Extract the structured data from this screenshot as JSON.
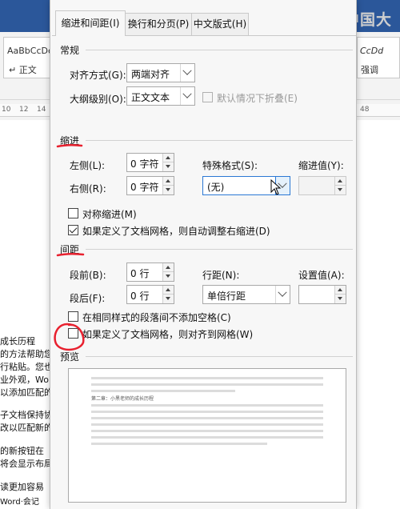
{
  "logo": {
    "text": "中国大"
  },
  "ribbon": {
    "style_left_1": "AaBbCcDc",
    "style_left_2": "↵ 正文",
    "style_right_1": "CcDd",
    "style_right_2": "强调"
  },
  "ruler": {
    "left_ticks": [
      "10",
      "12",
      "14"
    ],
    "right_tick": "48"
  },
  "document": {
    "lines": [
      "成长历程",
      "的方法帮助您",
      "行粘贴。您也",
      "业外观，Wor",
      "以添加匹配的",
      "子文档保持协",
      "改以匹配新的",
      "的新按钮在",
      "将会显示布局",
      "读更加容易",
      "Word·会记"
    ]
  },
  "dialog": {
    "tabs": [
      "缩进和间距(I)",
      "换行和分页(P)",
      "中文版式(H)"
    ],
    "general": {
      "title": "常规",
      "alignment_label": "对齐方式(G):",
      "alignment_value": "两端对齐",
      "outline_label": "大纲级别(O):",
      "outline_value": "正文文本",
      "collapse_label": "默认情况下折叠(E)"
    },
    "indent": {
      "title": "缩进",
      "left_label": "左侧(L):",
      "left_value": "0 字符",
      "right_label": "右侧(R):",
      "right_value": "0 字符",
      "special_label": "特殊格式(S):",
      "special_value": "(无)",
      "by_label": "缩进值(Y):",
      "by_value": "",
      "mirror_label": "对称缩进(M)",
      "auto_adjust_label": "如果定义了文档网格，则自动调整右缩进(D)"
    },
    "spacing": {
      "title": "间距",
      "before_label": "段前(B):",
      "before_value": "0 行",
      "after_label": "段后(F):",
      "after_value": "0 行",
      "line_spacing_label": "行距(N):",
      "line_spacing_value": "单倍行距",
      "at_label": "设置值(A):",
      "at_value": "",
      "no_space_label": "在相同样式的段落间不添加空格(C)",
      "snap_grid_label": "如果定义了文档网格，则对齐到网格(W)"
    },
    "preview": {
      "title": "预览",
      "sample_text": "第二章：小黑老师的成长历程"
    }
  },
  "colors": {
    "annotation": "#e8212f",
    "focus": "#2b78d4"
  },
  "checkbox_states": {
    "mirror": false,
    "auto_adjust": true,
    "no_space": false,
    "snap_grid": false,
    "collapse": false
  }
}
